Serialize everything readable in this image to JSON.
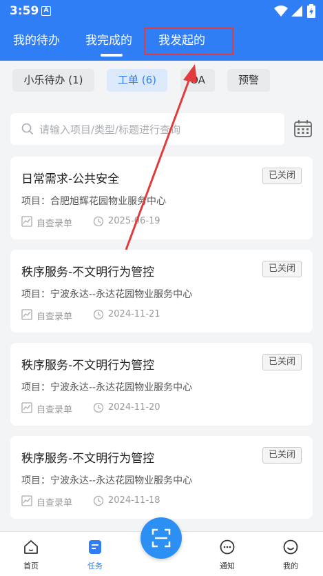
{
  "status": {
    "time": "3:59",
    "notification_letter": "A"
  },
  "tabs": [
    {
      "label": "我的待办"
    },
    {
      "label": "我完成的"
    },
    {
      "label": "我发起的"
    }
  ],
  "filters": [
    {
      "label": "小乐待办 (1)"
    },
    {
      "label": "工单 (6)"
    },
    {
      "label": "OA"
    },
    {
      "label": "预警"
    }
  ],
  "search": {
    "placeholder": "请输入项目/类型/标题进行查询"
  },
  "cards": [
    {
      "title": "日常需求-公共安全",
      "status": "已关闭",
      "project": "项目：合肥旭辉花园物业服务中心",
      "type": "自查录单",
      "date": "2025-06-19"
    },
    {
      "title": "秩序服务-不文明行为管控",
      "status": "已关闭",
      "project": "项目：宁波永达--永达花园物业服务中心",
      "type": "自查录单",
      "date": "2024-11-21"
    },
    {
      "title": "秩序服务-不文明行为管控",
      "status": "已关闭",
      "project": "项目：宁波永达--永达花园物业服务中心",
      "type": "自查录单",
      "date": "2024-11-20"
    },
    {
      "title": "秩序服务-不文明行为管控",
      "status": "已关闭",
      "project": "项目：宁波永达--永达花园物业服务中心",
      "type": "自查录单",
      "date": "2024-11-18"
    }
  ],
  "bottom_nav": [
    {
      "label": "首页"
    },
    {
      "label": "任务"
    },
    {
      "label": "通知"
    },
    {
      "label": "我的"
    }
  ],
  "colors": {
    "primary": "#2f7ef6",
    "annotation_red": "#e23b3b"
  }
}
